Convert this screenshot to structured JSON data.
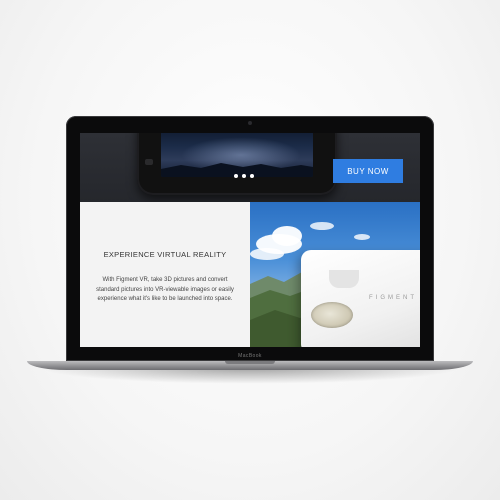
{
  "hero": {
    "carousel_dots": 3,
    "buy_button_label": "BUY NOW",
    "accent_color": "#2f7de1"
  },
  "feature": {
    "title": "EXPERIENCE VIRTUAL REALITY",
    "description": "With Figment VR, take 3D pictures and convert standard pictures into VR-viewable images or easily experience what it's like to be launched into space.",
    "headset_brand": "FIGMENT"
  },
  "device": {
    "brand_label": "MacBook"
  },
  "icons": [
    "camera-icon",
    "carousel-dot-icon"
  ]
}
